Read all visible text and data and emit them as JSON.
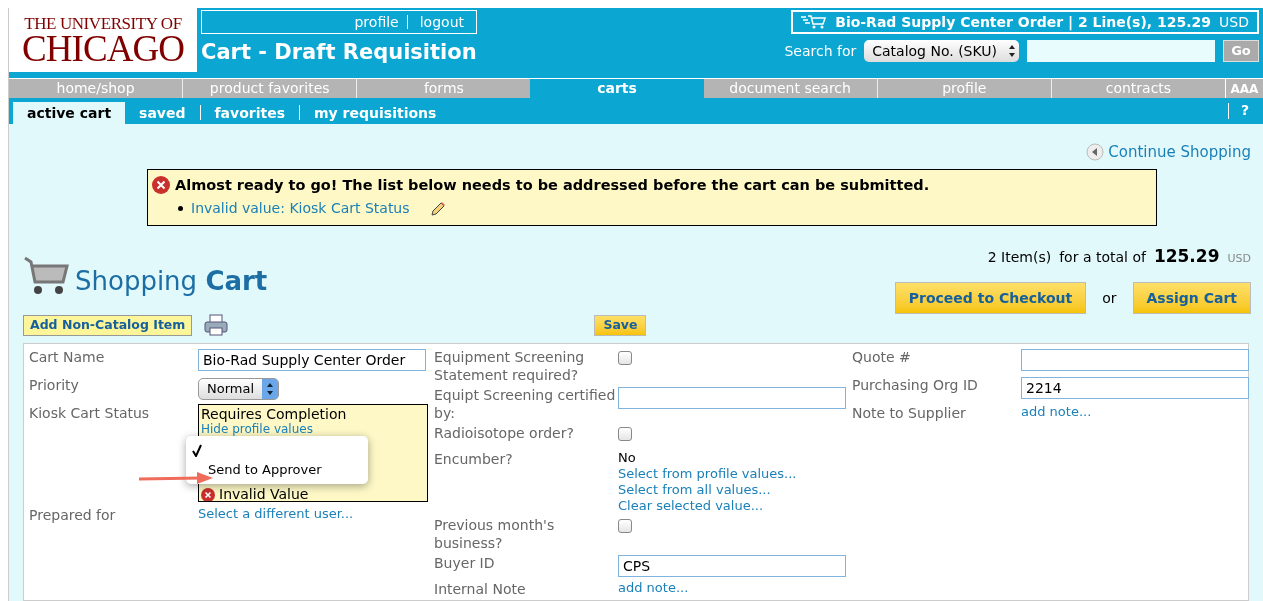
{
  "header": {
    "logo_top": "THE UNIVERSITY OF",
    "logo_main": "CHICAGO",
    "user_links": [
      "profile",
      "logout"
    ],
    "title": "Cart - Draft Requisition",
    "cart_summary": "Bio-Rad Supply Center Order | 2 Line(s), 125.29",
    "cart_currency": "USD",
    "search_label": "Search for",
    "search_type": "Catalog No. (SKU)",
    "search_button": "Go"
  },
  "nav": [
    {
      "label": "home/shop",
      "selected": false
    },
    {
      "label": "product favorites",
      "selected": false
    },
    {
      "label": "forms",
      "selected": false
    },
    {
      "label": "carts",
      "selected": true
    },
    {
      "label": "document search",
      "selected": false
    },
    {
      "label": "profile",
      "selected": false
    },
    {
      "label": "contracts",
      "selected": false
    }
  ],
  "font_sizer": "AAA",
  "subnav": [
    {
      "label": "active cart",
      "selected": true
    },
    {
      "label": "saved",
      "selected": false
    },
    {
      "label": "favorites",
      "selected": false
    },
    {
      "label": "my requisitions",
      "selected": false
    }
  ],
  "help": "?",
  "continue_link": "Continue Shopping",
  "alert": {
    "message": "Almost ready to go! The list below needs to be addressed before the cart can be submitted.",
    "items": [
      "Invalid value: Kiosk Cart Status"
    ]
  },
  "cart_heading": {
    "light": "Shopping",
    "bold": "Cart"
  },
  "totals": {
    "items": "2 Item(s)",
    "for_text": "for a total of",
    "amount": "125.29",
    "currency": "USD"
  },
  "actions": {
    "add_item": "Add Non-Catalog Item",
    "save": "Save",
    "checkout": "Proceed to Checkout",
    "or": "or",
    "assign": "Assign Cart"
  },
  "column_a": [
    {
      "label": "Cart Name",
      "kind": "input",
      "value": "Bio-Rad Supply Center Order"
    },
    {
      "label": "Priority",
      "kind": "select",
      "value": "Normal"
    },
    {
      "label": "Kiosk Cart Status",
      "kind": "status",
      "status": "Requires Completion",
      "link": "Hide profile values",
      "error": "Invalid Value"
    },
    {
      "label": "Prepared for",
      "kind": "links",
      "links": [
        "Select a different user..."
      ]
    }
  ],
  "column_b": [
    {
      "label": "Equipment Screening Statement required?",
      "kind": "checkbox",
      "checked": false
    },
    {
      "label": "Equipt Screening certified by:",
      "kind": "input"
    },
    {
      "label": "Radioisotope order?",
      "kind": "checkbox",
      "checked": false
    },
    {
      "label": "Encumber?",
      "kind": "links",
      "value": "No",
      "links": [
        "Select from profile values...",
        "Select from all values...",
        "Clear selected value..."
      ]
    },
    {
      "label": "Previous month's business?",
      "kind": "checkbox",
      "checked": false
    },
    {
      "label": "Buyer ID",
      "kind": "input",
      "value": "CPS"
    },
    {
      "label": "Internal Note",
      "kind": "links",
      "links": [
        "add note..."
      ]
    }
  ],
  "column_c": [
    {
      "label": "Quote #",
      "kind": "input"
    },
    {
      "label": "Purchasing Org ID",
      "kind": "input",
      "value": "2214"
    },
    {
      "label": "Note to Supplier",
      "kind": "links",
      "links": [
        "add note..."
      ]
    }
  ],
  "popup_menu": [
    {
      "checked": true
    },
    {
      "label": "Send to Approver",
      "checked": false
    }
  ]
}
